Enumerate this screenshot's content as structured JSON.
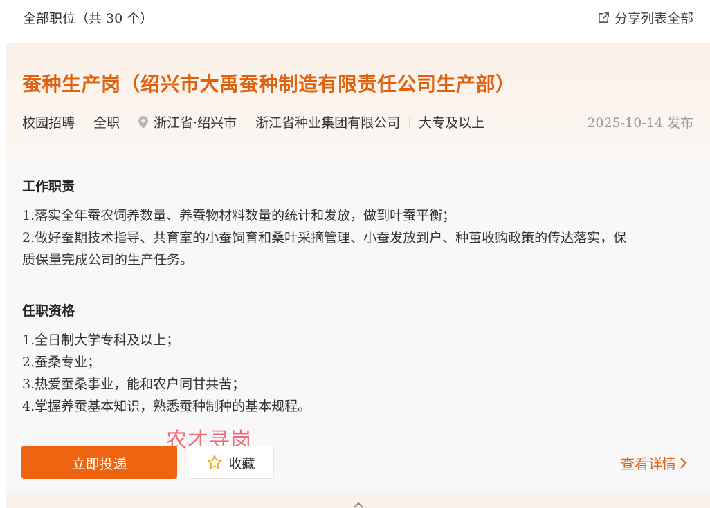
{
  "header": {
    "total_label": "全部职位（共 30 个）",
    "share_label": "分享列表全部"
  },
  "job": {
    "title": "蚕种生产岗（绍兴市大禹蚕种制造有限责任公司生产部）",
    "tags": {
      "recruit_type": "校园招聘",
      "job_type": "全职",
      "location": "浙江省·绍兴市",
      "company": "浙江省种业集团有限公司",
      "education": "大专及以上"
    },
    "publish_date": "2025-10-14 发布",
    "duties": {
      "title": "工作职责",
      "lines": [
        "1.落实全年蚕农饲养数量、养蚕物材料数量的统计和发放，做到叶蚕平衡；",
        "2.做好蚕期技术指导、共育室的小蚕饲育和桑叶采摘管理、小蚕发放到户、种茧收购政策的传达落实，保",
        "质保量完成公司的生产任务。"
      ]
    },
    "requirements": {
      "title": "任职资格",
      "lines": [
        "1.全日制大学专科及以上；",
        "2.蚕桑专业；",
        "3.热爱蚕桑事业，能和农户同甘共苦；",
        "4.掌握养蚕基本知识，熟悉蚕种制种的基本规程。"
      ]
    }
  },
  "watermark": "农才寻岗",
  "actions": {
    "apply_label": "立即投递",
    "favorite_label": "收藏",
    "detail_label": "查看详情"
  },
  "colors": {
    "accent": "#ee6411",
    "title": "#e0600d",
    "watermark": "#f2697a"
  },
  "icons": [
    "share-icon",
    "location-pin-icon",
    "star-icon",
    "chevron-right-icon",
    "chevron-up-icon"
  ]
}
